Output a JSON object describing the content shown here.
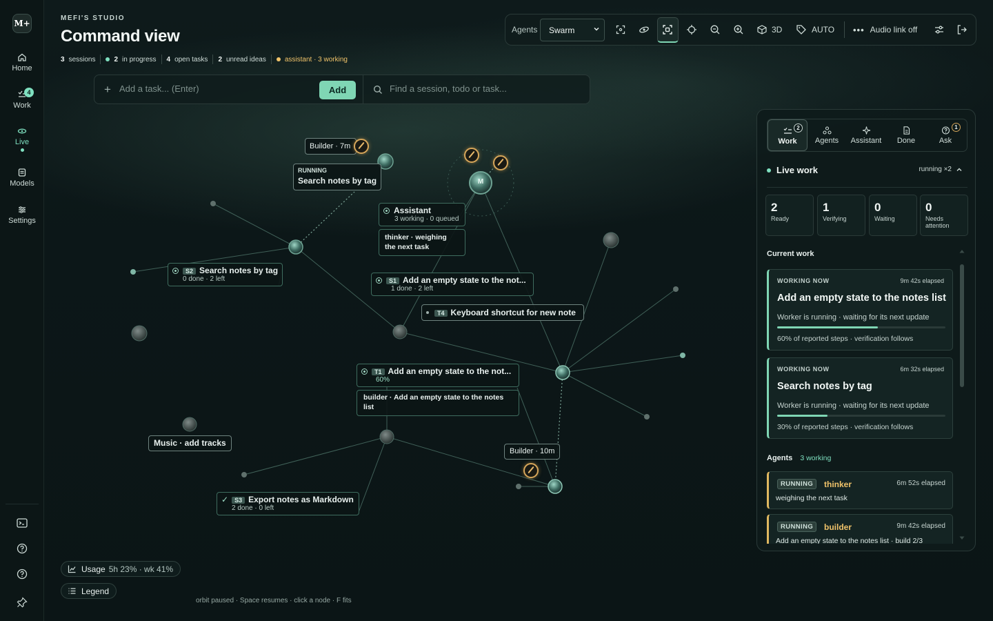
{
  "sidebar": {
    "logo": "M+",
    "items": [
      {
        "label": "Home",
        "icon": "home-icon"
      },
      {
        "label": "Work",
        "icon": "work-icon",
        "badge": "4"
      },
      {
        "label": "Live",
        "icon": "live-icon"
      },
      {
        "label": "Models",
        "icon": "models-icon"
      },
      {
        "label": "Settings",
        "icon": "settings-icon"
      }
    ],
    "bottom_icons": [
      "terminal-icon",
      "help-icon",
      "question-icon",
      "pin-icon"
    ]
  },
  "header": {
    "eyebrow": "MEFI'S STUDIO",
    "title": "Command view",
    "stats": [
      {
        "num": "3",
        "label": "sessions"
      },
      {
        "num": "2",
        "label": "in progress"
      },
      {
        "num": "4",
        "label": "open tasks"
      },
      {
        "num": "2",
        "label": "unread ideas"
      },
      {
        "label": "assistant · 3 working"
      }
    ]
  },
  "taskbar": {
    "placeholder": "Add a task... (Enter)",
    "add_label": "Add",
    "search_placeholder": "Find a session, todo or task..."
  },
  "toolbar": {
    "agents_label": "Agents",
    "agents_value": "Swarm",
    "btn_3d": "3D",
    "btn_auto": "AUTO",
    "audio_label": "Audio link off"
  },
  "graph": {
    "builder_top": "Builder · 7m",
    "running_tag": "RUNNING",
    "running_title": "Search notes by tag",
    "assistant_label": "Assistant",
    "assistant_sub": "3 working · 0 queued",
    "assistant_center": "M",
    "thinker_label": "thinker · weighing the next task",
    "s2_tag": "S2",
    "s2_title": "Search notes by tag",
    "s2_sub": "0 done · 2 left",
    "s1_tag": "S1",
    "s1_title": "Add an empty state to the not...",
    "s1_sub": "1 done · 2 left",
    "t4_tag": "T4",
    "t4_title": "Keyboard shortcut for new note",
    "t1_tag": "T1",
    "t1_title": "Add an empty state to the not...",
    "t1_sub": "60%",
    "builder_task": "builder · Add an empty state to the notes list",
    "music_label": "Music · add tracks",
    "builder_bottom": "Builder · 10m",
    "s3_tag": "S3",
    "s3_title": "Export notes as Markdown",
    "s3_sub": "2 done · 0 left"
  },
  "usage": {
    "label": "Usage",
    "value": "5h 23% · wk 41%"
  },
  "legend": {
    "label": "Legend"
  },
  "hint": "orbit paused · Space resumes · click a node · F fits",
  "panel": {
    "tabs": [
      {
        "label": "Work",
        "badge": "2"
      },
      {
        "label": "Agents"
      },
      {
        "label": "Assistant"
      },
      {
        "label": "Done"
      },
      {
        "label": "Ask",
        "badge": "1"
      }
    ],
    "live_title": "Live work",
    "live_status": "running ×2",
    "counts": [
      {
        "num": "2",
        "label": "Ready"
      },
      {
        "num": "1",
        "label": "Verifying"
      },
      {
        "num": "0",
        "label": "Waiting"
      },
      {
        "num": "0",
        "label": "Needs attention"
      }
    ],
    "current_work_title": "Current work",
    "work": [
      {
        "eyebrow": "WORKING NOW",
        "elapsed": "9m 42s elapsed",
        "title": "Add an empty state to the notes list",
        "status": "Worker is running · waiting for its next update",
        "progress": 0.6,
        "note": "60% of reported steps · verification follows"
      },
      {
        "eyebrow": "WORKING NOW",
        "elapsed": "6m 32s elapsed",
        "title": "Search notes by tag",
        "status": "Worker is running · waiting for its next update",
        "progress": 0.3,
        "note": "30% of reported steps · verification follows"
      }
    ],
    "agents_title": "Agents",
    "agents_count": "3 working",
    "agents": [
      {
        "tag": "RUNNING",
        "name": "thinker",
        "elapsed": "6m 52s elapsed",
        "task": "weighing the next task"
      },
      {
        "tag": "RUNNING",
        "name": "builder",
        "elapsed": "9m 42s elapsed",
        "task": "Add an empty state to the notes list · build 2/3"
      }
    ]
  }
}
